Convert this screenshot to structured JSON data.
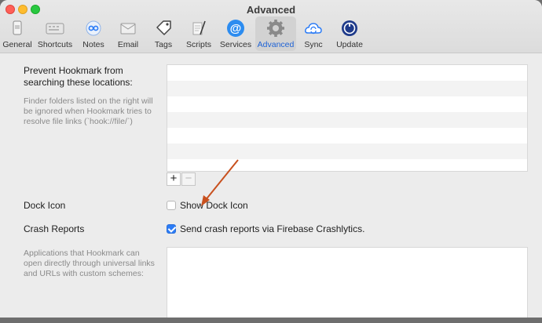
{
  "window": {
    "title": "Advanced"
  },
  "toolbar": {
    "items": [
      {
        "label": "General",
        "icon": "general-icon"
      },
      {
        "label": "Shortcuts",
        "icon": "keyboard-icon"
      },
      {
        "label": "Notes",
        "icon": "notes-icon"
      },
      {
        "label": "Email",
        "icon": "email-icon"
      },
      {
        "label": "Tags",
        "icon": "tag-icon"
      },
      {
        "label": "Scripts",
        "icon": "script-icon"
      },
      {
        "label": "Services",
        "icon": "at-sign-icon"
      },
      {
        "label": "Advanced",
        "icon": "gear-icon",
        "active": true
      },
      {
        "label": "Sync",
        "icon": "cloud-sync-icon"
      },
      {
        "label": "Update",
        "icon": "update-icon"
      }
    ]
  },
  "prevent": {
    "title": "Prevent Hookmark from searching these locations:",
    "description": "Finder folders listed on the right will be ignored when Hookmark tries to resolve file links (`hook://file/`)",
    "add_label": "+",
    "remove_label": "−"
  },
  "dock": {
    "label": "Dock Icon",
    "checkbox_label": "Show Dock Icon",
    "checked": false
  },
  "crash": {
    "label": "Crash Reports",
    "checkbox_label": "Send crash reports via Firebase Crashlytics.",
    "checked": true
  },
  "universal": {
    "description": "Applications that Hookmark can open directly through universal links and URLs with custom schemes:"
  },
  "colors": {
    "accent": "#2c7cf6",
    "annotation_arrow": "#c8501e"
  }
}
